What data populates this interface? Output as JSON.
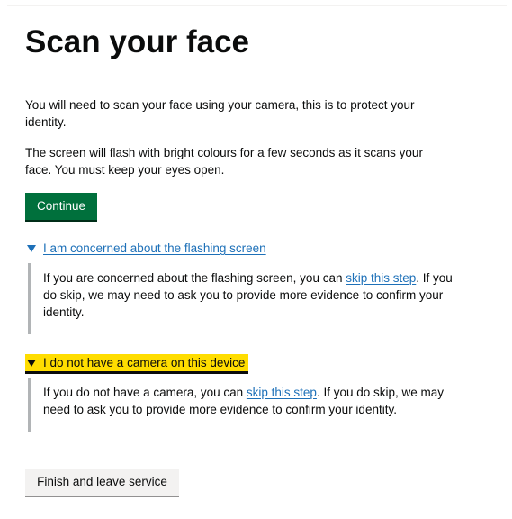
{
  "page": {
    "title": "Scan your face",
    "intro": "You will need to scan your face using your camera, this is to protect your identity.",
    "flash_warning": "The screen will flash with bright colours for a few seconds as it scans your face. You must keep your eyes open."
  },
  "buttons": {
    "continue_label": "Continue",
    "finish_label": "Finish and leave service"
  },
  "details": [
    {
      "summary": "I am concerned about the flashing screen",
      "body_before_link": "If you are concerned about the flashing screen, you can ",
      "link_text": "skip this step",
      "body_after_link": ". If you do skip, we may need to ask you to provide more evidence to confirm your identity.",
      "open": true,
      "focused": false
    },
    {
      "summary": "I do not have a camera on this device",
      "body_before_link": "If you do not have a camera, you can ",
      "link_text": "skip this step",
      "body_after_link": ". If you do skip, we may need to ask you to provide more evidence to confirm your identity.",
      "open": true,
      "focused": true
    }
  ],
  "colors": {
    "text": "#0b0c0c",
    "link": "#1d70b8",
    "primary_button": "#00703c",
    "secondary_button": "#f3f2f1",
    "focus": "#ffdd00",
    "details_border": "#b1b4b6"
  },
  "icons": {
    "details_toggle": "caret-down-icon"
  }
}
